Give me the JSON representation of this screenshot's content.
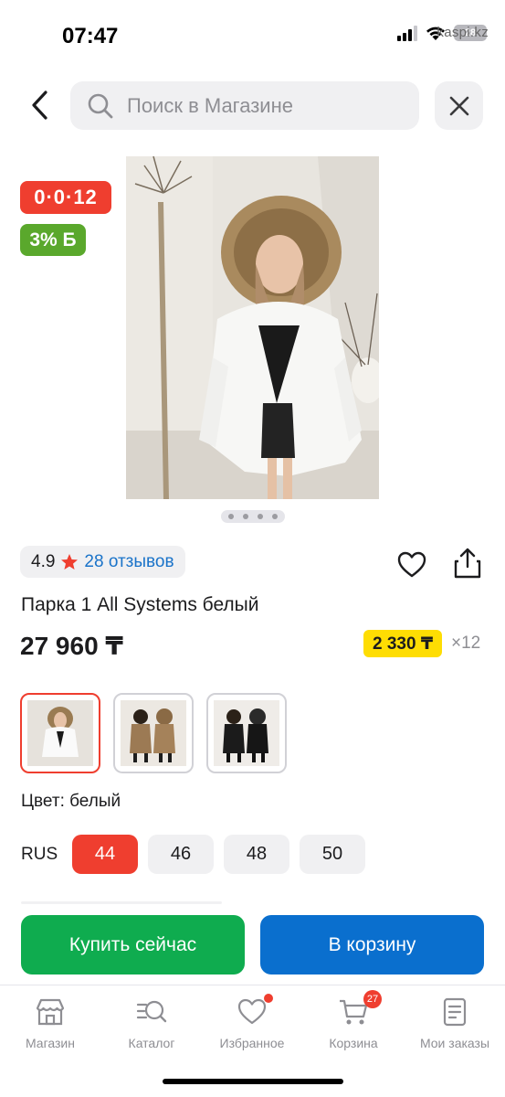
{
  "status_bar": {
    "time": "07:47",
    "battery": "28",
    "watermark": "kaspi.kz"
  },
  "search": {
    "placeholder": "Поиск в Магазине"
  },
  "badges": {
    "installment": "0·0·12",
    "bonus": "3% Б"
  },
  "rating": {
    "value": "4.9",
    "reviews": "28 отзывов"
  },
  "product": {
    "title": "Парка 1 All Systems белый",
    "price": "27 960 ₸",
    "monthly_payment": "2 330 ₸",
    "months": "×12",
    "color_label": "Цвет: белый",
    "size_system": "RUS",
    "sizes": [
      "44",
      "46",
      "48",
      "50"
    ],
    "selected_size": "44"
  },
  "actions": {
    "buy_now": "Купить сейчас",
    "add_to_cart": "В корзину"
  },
  "tabs": [
    {
      "label": "Магазин",
      "icon": "store-icon"
    },
    {
      "label": "Каталог",
      "icon": "catalog-search-icon"
    },
    {
      "label": "Избранное",
      "icon": "heart-icon"
    },
    {
      "label": "Корзина",
      "icon": "cart-icon",
      "badge": "27"
    },
    {
      "label": "Мои заказы",
      "icon": "orders-icon"
    }
  ],
  "colors": {
    "accent_red": "#ef3e2f",
    "bonus_green": "#5aa82c",
    "buy_green": "#0fac4f",
    "cart_blue": "#0a6fce",
    "link_blue": "#1a73c9",
    "price_yellow": "#fedd03"
  }
}
